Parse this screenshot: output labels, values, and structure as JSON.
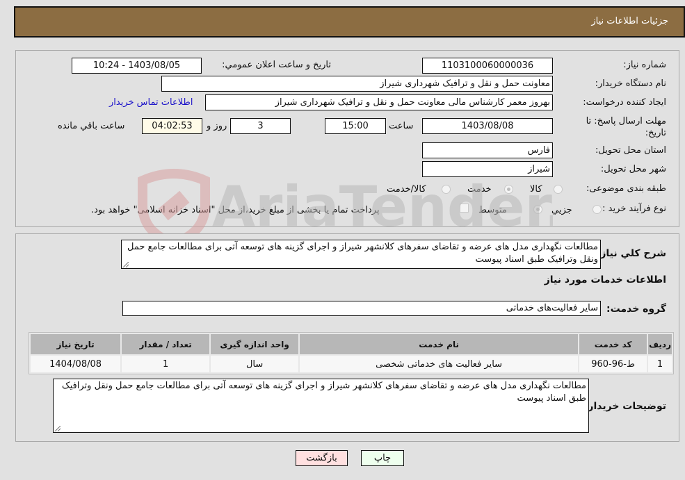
{
  "header": {
    "title": "جزئیات اطلاعات نیاز"
  },
  "form": {
    "need_number": {
      "label": "شماره نیاز:",
      "value": "1103100060000036"
    },
    "announce_datetime": {
      "label": "تاريخ و ساعت اعلان عمومي:",
      "value": "1403/08/05 - 10:24"
    },
    "buyer_org": {
      "label": "نام دستگاه خريدار:",
      "value": "معاونت حمل و نقل و ترافیک شهرداری شیراز"
    },
    "requester": {
      "label": "ايجاد کننده درخواست:",
      "value": "بهروز معمر کارشناس مالی معاونت حمل و نقل و ترافیک شهرداری شیراز",
      "contact_link": "اطلاعات تماس خريدار"
    },
    "deadline": {
      "label": "مهلت ارسال پاسخ: تا تاريخ:",
      "date": "1403/08/08",
      "time_label": "ساعت",
      "time": "15:00",
      "days": "3",
      "days_label": "روز و",
      "remaining": "04:02:53",
      "remaining_label": "ساعت باقي مانده"
    },
    "province": {
      "label": "استان محل تحويل:",
      "value": "فارس"
    },
    "city": {
      "label": "شهر محل تحويل:",
      "value": "شیراز"
    },
    "category": {
      "label": "طبقه بندی موضوعی:",
      "options": [
        "کالا",
        "خدمت",
        "کالا/خدمت"
      ],
      "selected": "خدمت"
    },
    "purchase_type": {
      "label": "نوع فرآيند خريد :",
      "options": [
        "جزيي",
        "متوسط"
      ],
      "selected": "متوسط",
      "treasury_note": "پرداخت تمام يا بخشی از مبلغ خريد،از محل \"اسناد خزانه اسلامی\" خواهد بود."
    }
  },
  "description": {
    "label": "شرح کلي نياز:",
    "text": "مطالعات نگهداری مدل های عرضه و تقاضای سفرهای کلانشهر شیراز و اجرای گزینه های توسعه آتی برای مطالعات جامع حمل ونقل وترافیک  طبق اسناد پیوست"
  },
  "services": {
    "section_title": "اطلاعات خدمات مورد نياز",
    "group_label": "گروه خدمت:",
    "group_value": "سایر فعالیت‌های خدماتی",
    "columns": [
      "رديف",
      "کد خدمت",
      "نام خدمت",
      "واحد اندازه گيری",
      "تعداد / مقدار",
      "تاريخ نياز"
    ],
    "rows": [
      [
        "1",
        "ط-96-960",
        "سایر فعالیت های خدماتی شخصی",
        "سال",
        "1",
        "1404/08/08"
      ]
    ]
  },
  "buyer_notes": {
    "label": "توضيحات خريدار:",
    "text": "مطالعات نگهداری مدل های عرضه و تقاضای سفرهای کلانشهر شیراز و اجرای گزینه های توسعه آتی برای مطالعات جامع حمل ونقل وترافیک  طبق اسناد پیوست"
  },
  "buttons": {
    "print": "چاپ",
    "back": "بازگشت"
  },
  "watermark": {
    "text": "AriaTender.neT"
  },
  "colors": {
    "header_bg": "#8c6d42",
    "link": "#1b12c9",
    "print_bg": "#eeffee",
    "back_bg": "#ffe0e0"
  }
}
